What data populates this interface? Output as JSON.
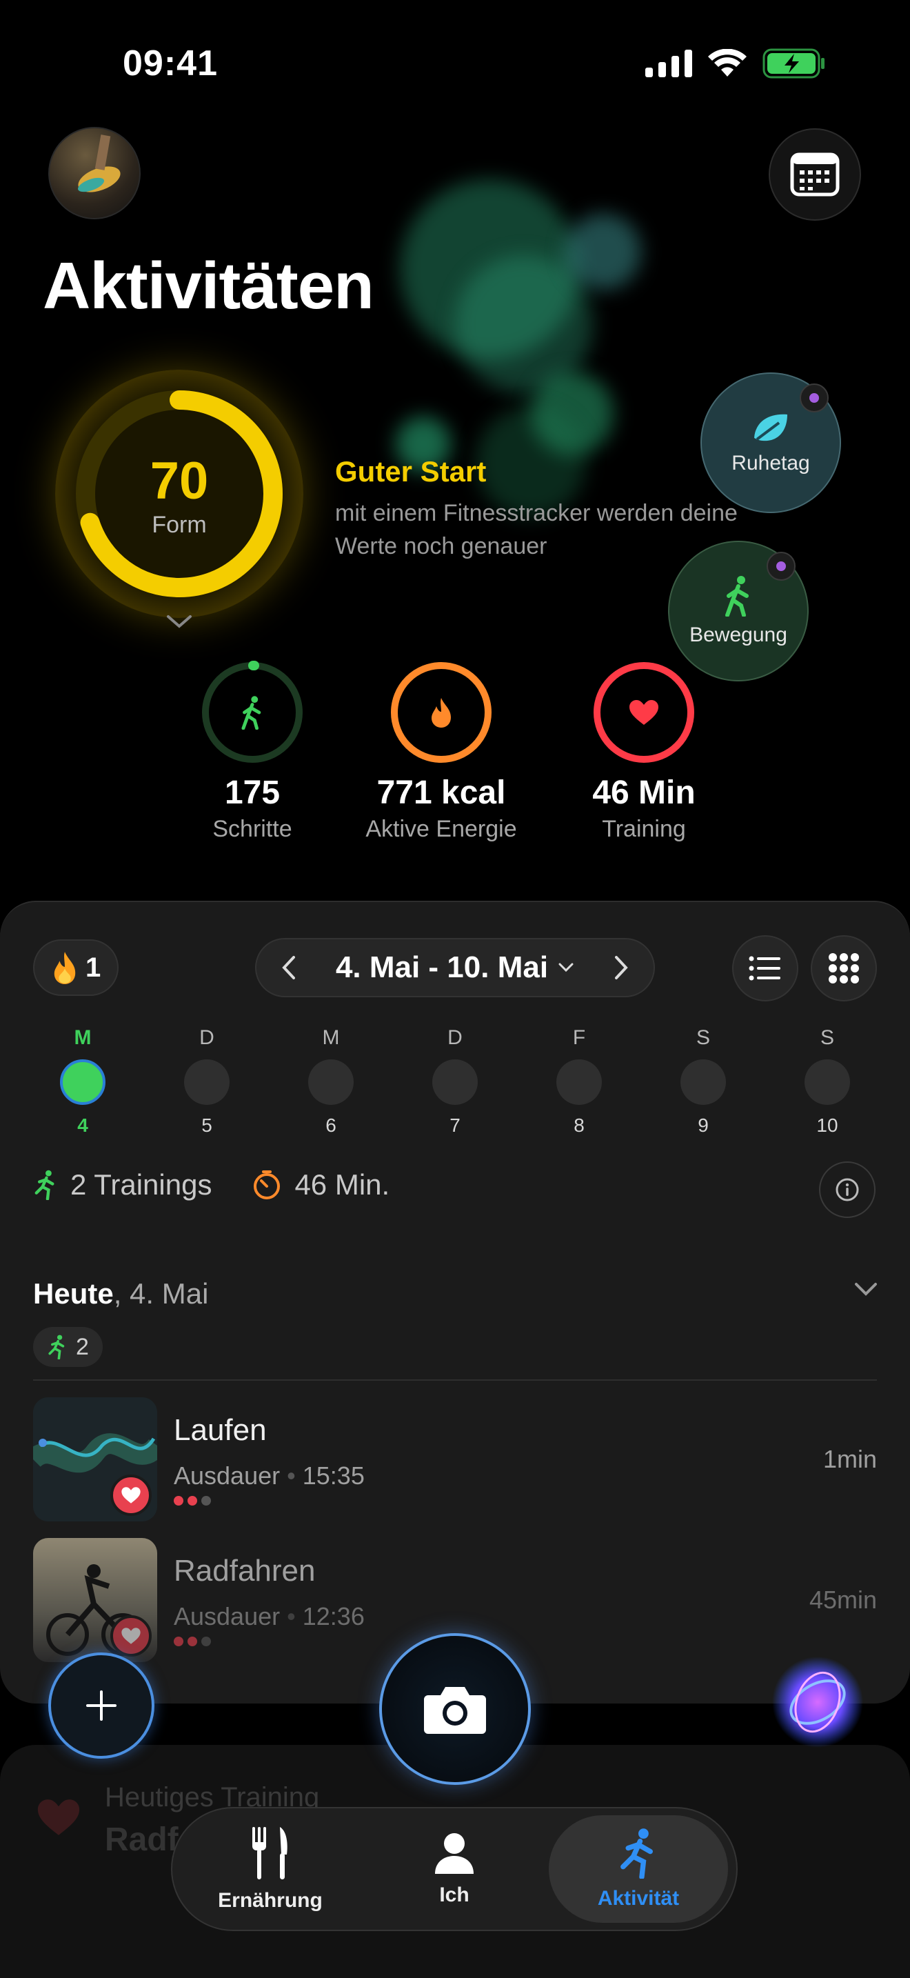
{
  "status": {
    "time": "09:41"
  },
  "header": {
    "title": "Aktivitäten"
  },
  "form": {
    "score": "70",
    "label": "Form",
    "level": 0.7,
    "headline": "Guter Start",
    "subtitle": "mit einem Fitnesstracker werden deine Werte noch genauer"
  },
  "bubbles": {
    "rest": "Ruhetag",
    "movement": "Bewegung"
  },
  "metrics": [
    {
      "value": "175",
      "label": "Schritte",
      "color": "#3fd15c"
    },
    {
      "value": "771 kcal",
      "label": "Aktive Energie",
      "color": "#ff8a2b"
    },
    {
      "value": "46 Min",
      "label": "Training",
      "color": "#ff3b47"
    }
  ],
  "week": {
    "streak": "1",
    "range": "4. Mai - 10. Mai",
    "days": [
      {
        "d": "M",
        "n": "4"
      },
      {
        "d": "D",
        "n": "5"
      },
      {
        "d": "M",
        "n": "6"
      },
      {
        "d": "D",
        "n": "7"
      },
      {
        "d": "F",
        "n": "8"
      },
      {
        "d": "S",
        "n": "9"
      },
      {
        "d": "S",
        "n": "10"
      }
    ],
    "trainings": "2 Trainings",
    "minutes": "46 Min."
  },
  "today": {
    "label": "Heute",
    "date": ", 4. Mai",
    "count": "2"
  },
  "activities": [
    {
      "name": "Laufen",
      "category": "Ausdauer",
      "time": "15:35",
      "duration": "1min"
    },
    {
      "name": "Radfahren",
      "category": "Ausdauer",
      "time": "12:36",
      "duration": "45min"
    }
  ],
  "ghost": {
    "line1": "Heutiges Training",
    "line2": "Radf"
  },
  "tabs": {
    "nutrition": "Ernährung",
    "me": "Ich",
    "activity": "Aktivität"
  },
  "colors": {
    "accent": "#f4cd00",
    "active_tab": "#2f8ff5",
    "green": "#3fd15c"
  }
}
